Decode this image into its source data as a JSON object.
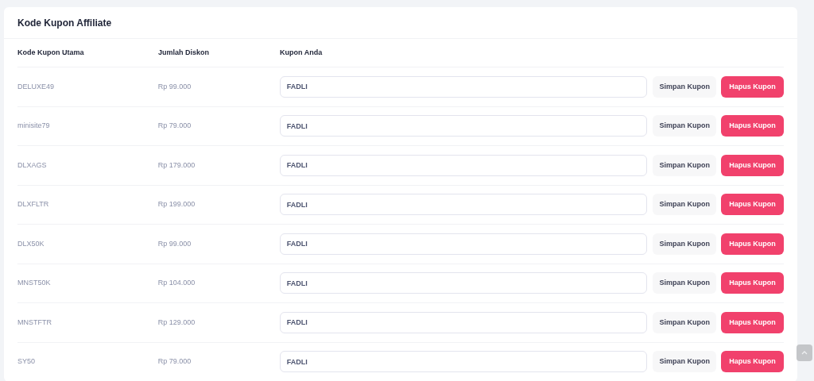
{
  "card": {
    "title": "Kode Kupon Affiliate"
  },
  "table": {
    "columns": [
      "Kode Kupon Utama",
      "Jumlah Diskon",
      "Kupon Anda"
    ],
    "rows": [
      {
        "code": "DELUXE49",
        "discount": "Rp 99.000",
        "coupon": "FADLI",
        "save": "Simpan Kupon",
        "delete": "Hapus Kupon"
      },
      {
        "code": "minisite79",
        "discount": "Rp 79.000",
        "coupon": "FADLI",
        "save": "Simpan Kupon",
        "delete": "Hapus Kupon"
      },
      {
        "code": "DLXAGS",
        "discount": "Rp 179.000",
        "coupon": "FADLI",
        "save": "Simpan Kupon",
        "delete": "Hapus Kupon"
      },
      {
        "code": "DLXFLTR",
        "discount": "Rp 199.000",
        "coupon": "FADLI",
        "save": "Simpan Kupon",
        "delete": "Hapus Kupon"
      },
      {
        "code": "DLX50K",
        "discount": "Rp 99.000",
        "coupon": "FADLI",
        "save": "Simpan Kupon",
        "delete": "Hapus Kupon"
      },
      {
        "code": "MNST50K",
        "discount": "Rp 104.000",
        "coupon": "FADLI",
        "save": "Simpan Kupon",
        "delete": "Hapus Kupon"
      },
      {
        "code": "MNSTFTR",
        "discount": "Rp 129.000",
        "coupon": "FADLI",
        "save": "Simpan Kupon",
        "delete": "Hapus Kupon"
      },
      {
        "code": "SY50",
        "discount": "Rp 79.000",
        "coupon": "FADLI",
        "save": "Simpan Kupon",
        "delete": "Hapus Kupon"
      }
    ]
  }
}
